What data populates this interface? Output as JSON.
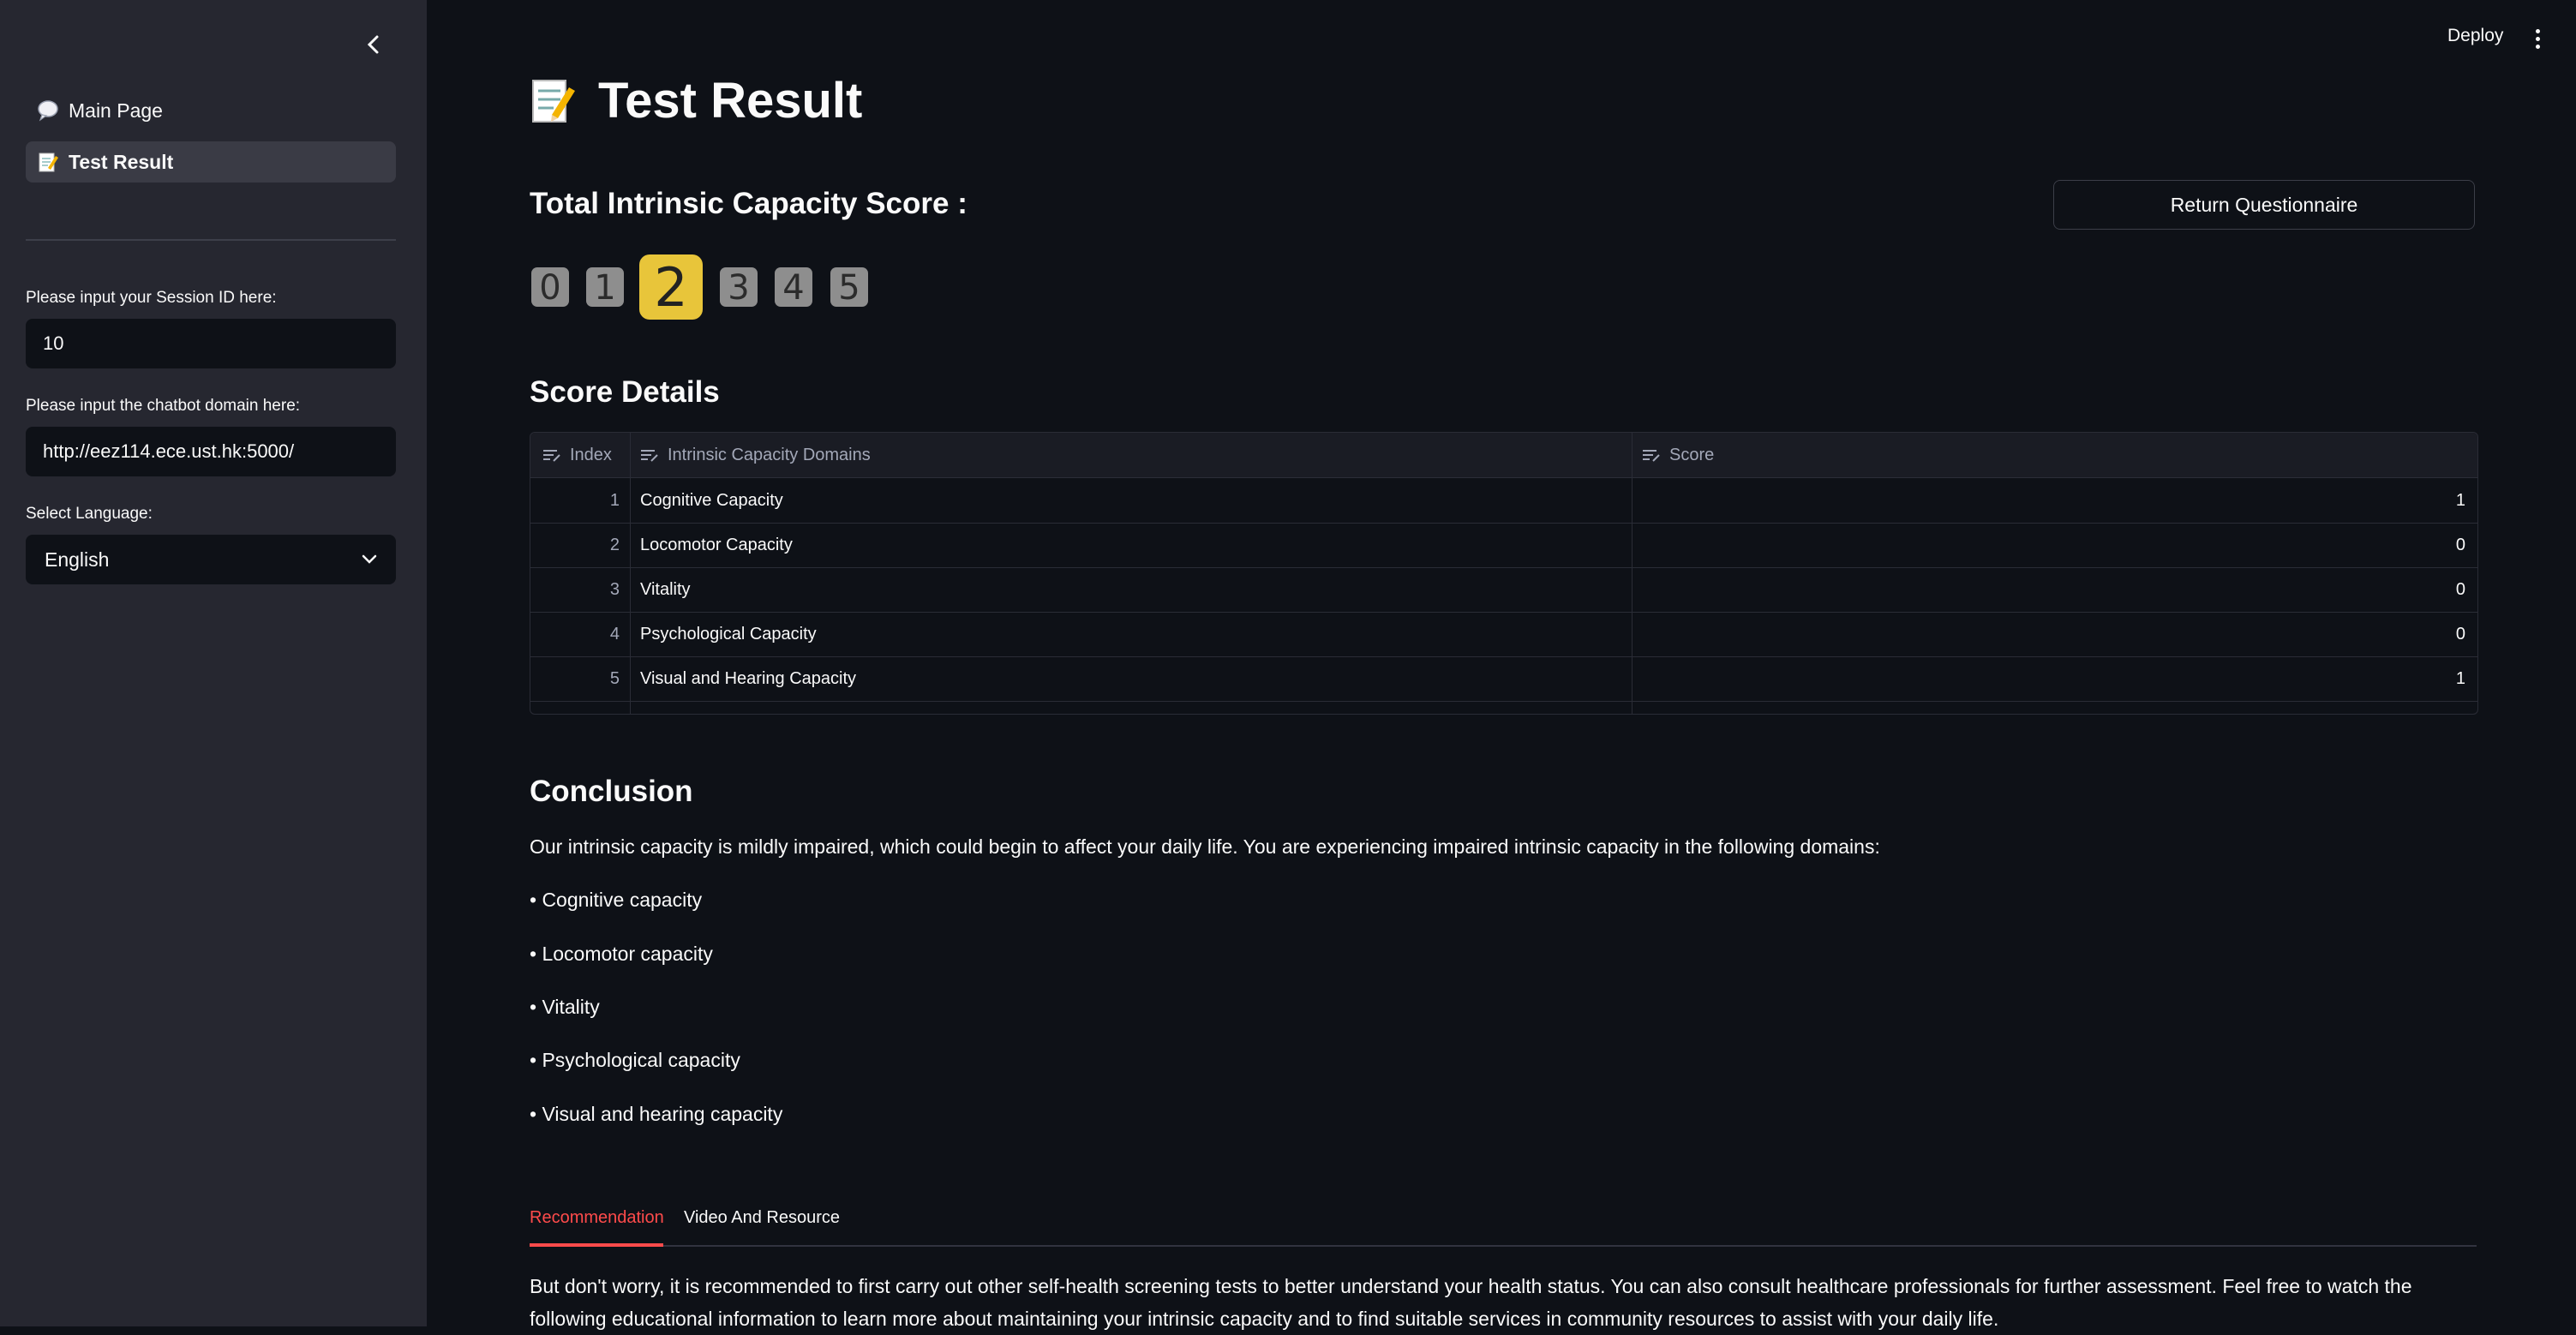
{
  "sidebar": {
    "nav": [
      {
        "label": "Main Page",
        "icon": "speech-bubble-icon"
      },
      {
        "label": "Test Result",
        "icon": "memo-icon",
        "active": true
      }
    ],
    "session_label": "Please input your Session ID here:",
    "session_value": "10",
    "domain_label": "Please input the chatbot domain here:",
    "domain_value": "http://eez114.ece.ust.hk:5000/",
    "language_label": "Select Language:",
    "language_value": "English"
  },
  "header": {
    "deploy_label": "Deploy"
  },
  "main": {
    "title": "Test Result",
    "score_title": "Total Intrinsic Capacity Score :",
    "return_button": "Return Questionnaire",
    "score_scale": {
      "options": [
        "0",
        "1",
        "2",
        "3",
        "4",
        "5"
      ],
      "selected": "2",
      "highlight_color": "#e8c53a",
      "inactive_color": "#8e8e8e"
    },
    "score_details_title": "Score Details",
    "table": {
      "columns": [
        "Index",
        "Intrinsic Capacity Domains",
        "Score"
      ],
      "rows": [
        {
          "index": "1",
          "domain": "Cognitive Capacity",
          "score": "1"
        },
        {
          "index": "2",
          "domain": "Locomotor Capacity",
          "score": "0"
        },
        {
          "index": "3",
          "domain": "Vitality",
          "score": "0"
        },
        {
          "index": "4",
          "domain": "Psychological Capacity",
          "score": "0"
        },
        {
          "index": "5",
          "domain": "Visual and Hearing Capacity",
          "score": "1"
        }
      ]
    },
    "conclusion_title": "Conclusion",
    "conclusion_text": "Our intrinsic capacity is mildly impaired, which could begin to affect your daily life. You are experiencing impaired intrinsic capacity in the following domains:",
    "conclusion_items": [
      "• Cognitive capacity",
      "• Locomotor capacity",
      "• Vitality",
      "• Psychological capacity",
      "• Visual and hearing capacity"
    ],
    "tabs": [
      "Recommendation",
      "Video And Resource"
    ],
    "active_tab": "Recommendation",
    "recommendation_text": "But don't worry, it is recommended to first carry out other self-health screening tests to better understand your health status. You can also consult healthcare professionals for further assessment. Feel free to watch the following educational information to learn more about maintaining your intrinsic capacity and to find suitable services in community resources to assist with your daily life."
  }
}
